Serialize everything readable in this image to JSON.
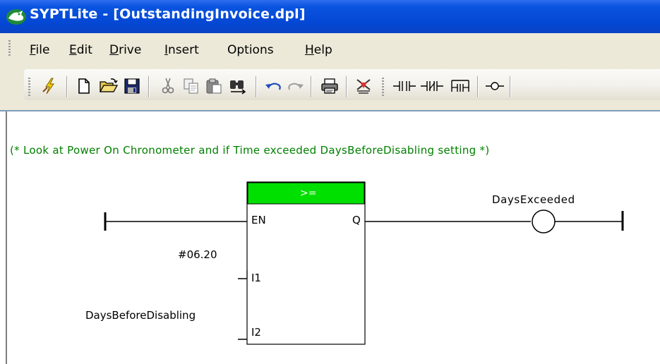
{
  "window": {
    "title": "SYPTLite - [OutstandingInvoice.dpl]",
    "icon": "syptlite-app-icon"
  },
  "menu": {
    "items": [
      {
        "label": "File",
        "accelerator_index": 0
      },
      {
        "label": "Edit",
        "accelerator_index": 0
      },
      {
        "label": "Drive",
        "accelerator_index": 0
      },
      {
        "label": "Insert",
        "accelerator_index": 0
      },
      {
        "label": "Options",
        "accelerator_index": -1
      },
      {
        "label": "Help",
        "accelerator_index": 0
      }
    ]
  },
  "toolbar": {
    "buttons": [
      "lightning-icon",
      "new-file-icon",
      "open-folder-icon",
      "save-icon",
      "cut-icon",
      "copy-icon",
      "paste-icon",
      "find-icon",
      "undo-icon",
      "redo-icon",
      "print-icon",
      "compile-icon",
      "contact-no-icon",
      "contact-nc-icon",
      "parallel-branch-icon",
      "coil-icon"
    ]
  },
  "ladder": {
    "comment": "(* Look at Power On Chronometer and if Time exceeded DaysBeforeDisabling setting *)",
    "block": {
      "operator": ">=",
      "header_color": "#00e000",
      "pin_en": "EN",
      "pin_q": "Q",
      "pin_i1": "I1",
      "pin_i2": "I2"
    },
    "inputs": {
      "i1": "#06.20",
      "i2": "DaysBeforeDisabling"
    },
    "coil": {
      "name": "DaysExceeded"
    },
    "comment_color": "#008000"
  }
}
